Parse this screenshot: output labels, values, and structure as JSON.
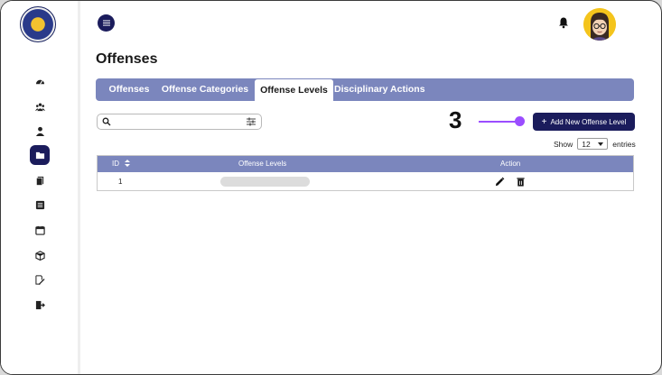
{
  "header": {
    "page_title": "Offenses"
  },
  "tabs": [
    {
      "label": "Offenses",
      "active": false
    },
    {
      "label": "Offense Categories",
      "active": false
    },
    {
      "label": "Offense Levels",
      "active": true
    },
    {
      "label": "Disciplinary Actions",
      "active": false
    }
  ],
  "search": {
    "value": "",
    "placeholder": ""
  },
  "annotation": {
    "step": "3",
    "color": "#9b4dff"
  },
  "add_button": {
    "icon": "+",
    "label": "Add New Offense Level"
  },
  "entries": {
    "show_label": "Show",
    "value": "12",
    "entries_label": "entries"
  },
  "table": {
    "headers": {
      "id": "ID",
      "levels": "Offense Levels",
      "action": "Action"
    },
    "rows": [
      {
        "id": "1",
        "level": ""
      }
    ]
  },
  "colors": {
    "primary": "#1b1c5c",
    "tab_bar": "#7b86bd",
    "accent": "#9b4dff"
  },
  "sidebar_icons": [
    "dashboard-icon",
    "group-icon",
    "user-icon",
    "folder-icon",
    "documents-icon",
    "list-icon",
    "calendar-icon",
    "box-icon",
    "edit-document-icon",
    "logout-icon"
  ]
}
